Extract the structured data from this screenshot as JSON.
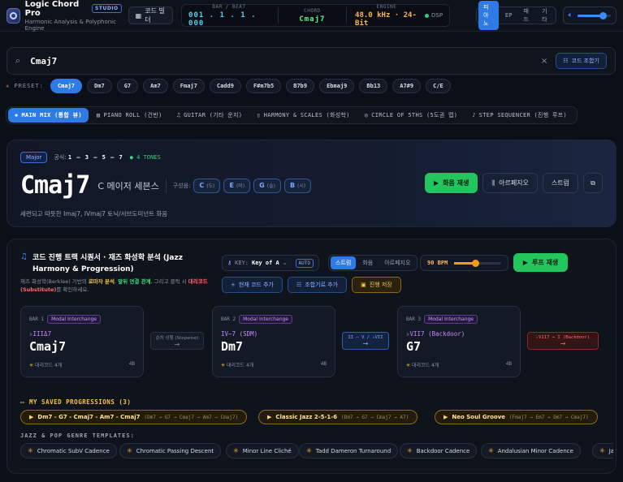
{
  "app": {
    "title": "Logic Chord Pro",
    "badge": "STUDIO",
    "subtitle": "Harmonic Analysis & Polyphonic Engine",
    "builder_button": "코드 빌더"
  },
  "lcd": {
    "bar_label": "BAR / BEAT",
    "bar_value": "001 . 1 . 1 . 000",
    "chord_label": "CHORD",
    "chord_value": "Cmaj7",
    "engine_label": "ENGINE",
    "engine_value": "48.0 kHz · 24-Bit",
    "dsp_label": "DSP"
  },
  "instruments": [
    "피아노",
    "EP",
    "패드",
    "기타"
  ],
  "instrument_selected": "피아노",
  "volume": {
    "level": 0.75
  },
  "search": {
    "value": "Cmaj7",
    "clear_label": "×",
    "combo_button": "코드 조합기"
  },
  "presets": {
    "label": "PRESET:",
    "items": [
      "Cmaj7",
      "Dm7",
      "G7",
      "Am7",
      "Fmaj7",
      "Cadd9",
      "F#m7b5",
      "B7b9",
      "Ebmaj9",
      "Bb13",
      "A7#9",
      "C/E"
    ],
    "selected": "Cmaj7"
  },
  "tabs": [
    {
      "label": "MAIN MIX (통합 뷰)",
      "icon": "layers-icon"
    },
    {
      "label": "PIANO ROLL (건반)",
      "icon": "piano-icon"
    },
    {
      "label": "GUITAR (기타 운지)",
      "icon": "music-note-icon"
    },
    {
      "label": "HARMONY & SCALES (화성학)",
      "icon": "book-icon"
    },
    {
      "label": "CIRCLE OF 5THS (5도권 맵)",
      "icon": "compass-icon"
    },
    {
      "label": "STEP SEQUENCER (진행 루프)",
      "icon": "note-icon"
    }
  ],
  "hero": {
    "quality": "Major",
    "formula_label": "공식:",
    "formula": "1 – 3 – 5 – 7",
    "tones": "4 TONES",
    "chord": "Cmaj7",
    "chord_name": "C 메이저 세븐스",
    "composition_label": "구성음:",
    "notes": [
      {
        "note": "C",
        "solfege": "(도)"
      },
      {
        "note": "E",
        "solfege": "(미)"
      },
      {
        "note": "G",
        "solfege": "(솔)"
      },
      {
        "note": "B",
        "solfege": "(시)"
      }
    ],
    "description": "세련되고 따뜻한 Imaj7, IVmaj7 토닉/서브도미넌트 화음",
    "play_button": "화음 재생",
    "arp_button": "아르페지오",
    "strum_button": "스트럼"
  },
  "panel": {
    "title": "코드 진행 트랙 시퀀서 · 재즈 화성학 분석 (Jazz Harmony & Progression)",
    "desc_1": "재즈 화성학(Berklee) 기반의 ",
    "desc_roman": "로마자 분석",
    "desc_2": ", ",
    "desc_voice": "앞뒤 연결 관계",
    "desc_3": ", 그리고 클릭 시 ",
    "desc_sub": "대리코드(Substitute)",
    "desc_4": "를 확인하세요.",
    "key_label": "KEY:",
    "key_value": "Key of A",
    "auto": "AUTO",
    "modes": [
      "스트럼",
      "화음",
      "아르페지오"
    ],
    "mode_selected": "스트럼",
    "bpm": "90 BPM",
    "bpm_level": 0.45,
    "loop_button": "루프 재생",
    "add_button": "현재 코드 추가",
    "combo_add_button": "조합기로 추가",
    "save_button": "진행 저장"
  },
  "progression": [
    {
      "bar": "BAR 1",
      "tag": "Modal Interchange",
      "function": "♭IIIΔ7",
      "chord": "Cmaj7",
      "subs": "대리코드 4개",
      "beats": "4B"
    },
    {
      "bar": "BAR 2",
      "tag": "Modal Interchange",
      "function": "IV–7 (SDM)",
      "chord": "Dm7",
      "subs": "대리코드 4개",
      "beats": "4B"
    },
    {
      "bar": "BAR 3",
      "tag": "Modal Interchange",
      "function": "♭VII7 (Backdoor)",
      "chord": "G7",
      "subs": "대리코드 4개",
      "beats": "4B"
    }
  ],
  "connectors": [
    {
      "label": "순차 상행 (Stepwise)",
      "arrow": "→"
    },
    {
      "label": "II – V / ♭VII",
      "arrow": "→"
    },
    {
      "label": "♭VII7 → I (Backdoor)",
      "arrow": "→"
    }
  ],
  "saved": {
    "title": "MY SAVED PROGRESSIONS (3)",
    "items": [
      {
        "name": "Dm7 - G7 - Cmaj7 - Am7 - Cmaj7",
        "chords": "(Dm7 → G7 → Cmaj7 → Am7 → Cmaj7)"
      },
      {
        "name": "Classic Jazz 2-5-1-6",
        "chords": "(Dm7 → G7 → Cmaj7 → A7)"
      },
      {
        "name": "Neo Soul Groove",
        "chords": "(Fmaj7 → Em7 → Dm7 → Cmaj7)"
      }
    ]
  },
  "templates": {
    "title": "JAZZ & POP GENRE TEMPLATES:",
    "items": [
      "Chromatic SubV Cadence",
      "Chromatic Passing Descent",
      "Minor Line Cliché",
      "Tadd Dameron Turnaround",
      "Backdoor Cadence",
      "Andalusian Minor Cadence",
      "Ja"
    ]
  },
  "colors": {
    "accent": "#2f7be6",
    "play": "#22c55e",
    "gold": "#f5c344",
    "modal": "#c68bff"
  }
}
